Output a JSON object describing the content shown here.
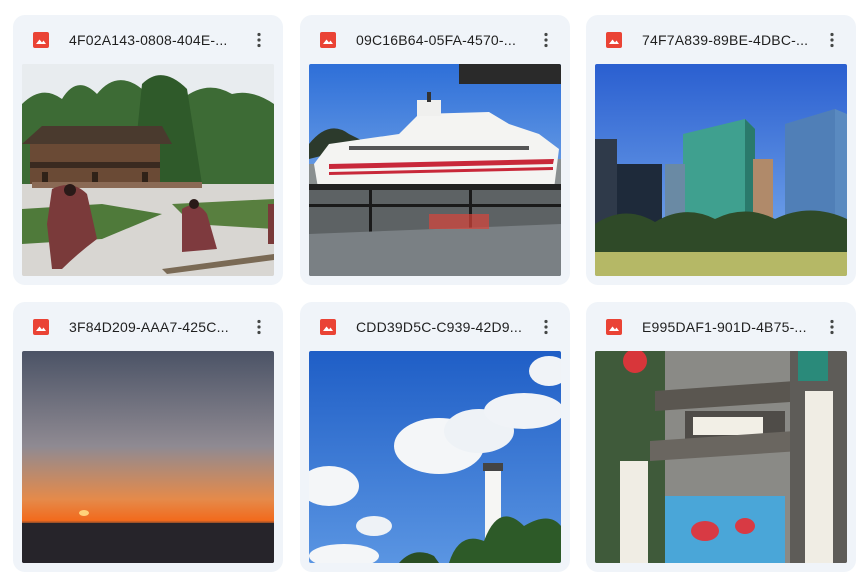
{
  "files": [
    {
      "name": "4F02A143-0808-404E-...",
      "icon": "image-file-icon",
      "thumbnail": "shrine-ceremony-photo"
    },
    {
      "name": "09C16B64-05FA-4570-...",
      "icon": "image-file-icon",
      "thumbnail": "ferry-ship-photo"
    },
    {
      "name": "74F7A839-89BE-4DBC-...",
      "icon": "image-file-icon",
      "thumbnail": "city-skyscrapers-photo"
    },
    {
      "name": "3F84D209-AAA7-425C...",
      "icon": "image-file-icon",
      "thumbnail": "sunset-cityscape-photo"
    },
    {
      "name": "CDD39D5C-C939-42D9...",
      "icon": "image-file-icon",
      "thumbnail": "lighthouse-sky-photo"
    },
    {
      "name": "E995DAF1-901D-4B75-...",
      "icon": "image-file-icon",
      "thumbnail": "temple-gate-photo"
    }
  ],
  "colors": {
    "card_bg": "#f0f4f9",
    "icon_red": "#ea4335",
    "text": "#1f1f1f"
  }
}
